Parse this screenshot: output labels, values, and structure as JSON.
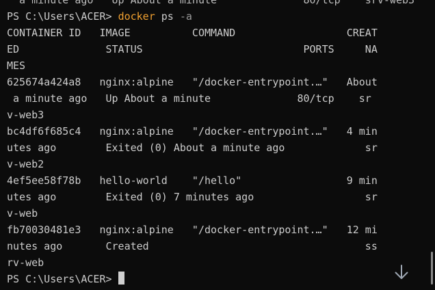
{
  "terminal": {
    "top_clipped_line": "  a minute ago   Up About a minute              80/tcp    srv-web3",
    "prompt": "PS C:\\Users\\ACER>",
    "command": "docker",
    "command_args": "ps",
    "command_flag": "-a",
    "output_lines": [
      "CONTAINER ID   IMAGE          COMMAND                  CREAT",
      "ED              STATUS                          PORTS     NA",
      "MES",
      "625674a424a8   nginx:alpine   \"/docker-entrypoint.…\"   About",
      " a minute ago   Up About a minute              80/tcp    sr",
      "v-web3",
      "bc4df6f685c4   nginx:alpine   \"/docker-entrypoint.…\"   4 min",
      "utes ago        Exited (0) About a minute ago             sr",
      "v-web2",
      "4ef5ee58f78b   hello-world    \"/hello\"                 9 min",
      "utes ago        Exited (0) 7 minutes ago                  sr",
      "v-web",
      "fb70030481e3   nginx:alpine   \"/docker-entrypoint.…\"   12 mi",
      "nutes ago       Created                                   ss",
      "rv-web"
    ],
    "final_prompt": "PS C:\\Users\\ACER>",
    "icons": {
      "scroll_to_bottom": "arrow-down-icon"
    },
    "colors": {
      "background": "#0c0c0c",
      "text": "#cccccc",
      "command": "#f0a030",
      "flag": "#9a9a9a"
    }
  }
}
